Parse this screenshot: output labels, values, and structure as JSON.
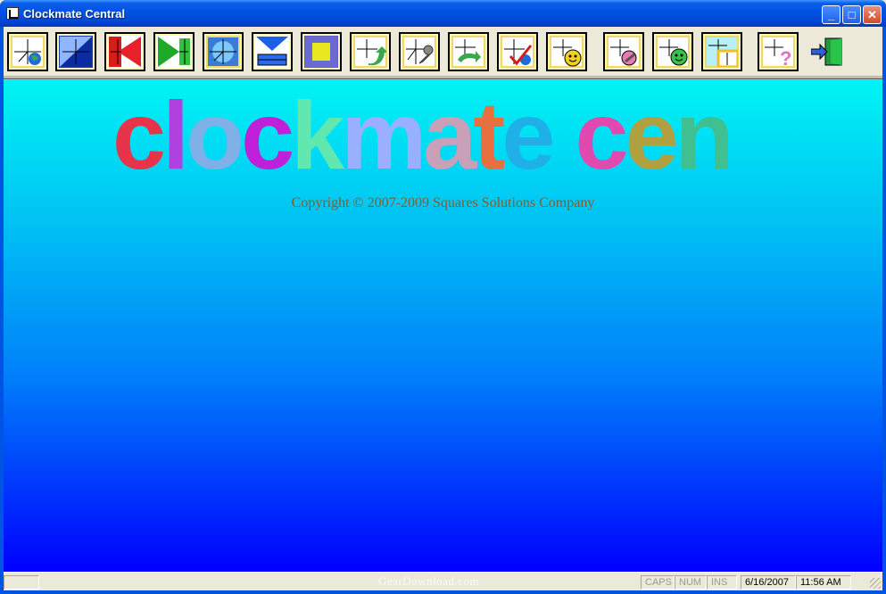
{
  "window": {
    "title": "Clockmate Central",
    "min_glyph": "_",
    "max_glyph": "□",
    "close_glyph": "✕"
  },
  "toolbar": {
    "buttons": [
      {
        "name": "clock-globe",
        "icon": "clock-globe-icon"
      },
      {
        "name": "blue-triangle",
        "icon": "blue-triangle-icon"
      },
      {
        "name": "red-arrow-left",
        "icon": "red-arrow-left-icon"
      },
      {
        "name": "green-arrow-right",
        "icon": "green-arrow-right-icon"
      },
      {
        "name": "clock-blue-star",
        "icon": "clock-blue-star-icon"
      },
      {
        "name": "download-tray",
        "icon": "download-tray-icon"
      },
      {
        "name": "yellow-square",
        "icon": "yellow-square-icon"
      },
      {
        "name": "clock-green-arrow",
        "icon": "clock-green-arrow-icon"
      },
      {
        "name": "clock-wrench",
        "icon": "clock-wrench-icon"
      },
      {
        "name": "clock-sync",
        "icon": "clock-sync-icon"
      },
      {
        "name": "clock-check",
        "icon": "clock-check-icon"
      },
      {
        "name": "clock-smiley",
        "icon": "clock-smiley-icon"
      },
      {
        "name": "clock-settings",
        "icon": "clock-settings-icon"
      },
      {
        "name": "clock-green-smiley",
        "icon": "clock-green-smiley-icon"
      },
      {
        "name": "clock-window",
        "icon": "clock-window-icon"
      },
      {
        "name": "clock-help",
        "icon": "clock-help-icon"
      },
      {
        "name": "exit-door",
        "icon": "exit-door-icon"
      }
    ]
  },
  "main": {
    "logo_text": "clockmate central",
    "copyright": "Copyright © 2007-2009 Squares Solutions Company"
  },
  "statusbar": {
    "watermark": "GearDownload.com",
    "caps": "CAPS",
    "num": "NUM",
    "ins": "INS",
    "date": "6/16/2007",
    "time": "11:56 AM"
  },
  "colors": {
    "titlebar": "#0054e3",
    "canvas_top": "#00f4f4",
    "canvas_bottom": "#0000ff",
    "button_face": "#f0d86a",
    "copyright_text": "#8b5a2b"
  }
}
